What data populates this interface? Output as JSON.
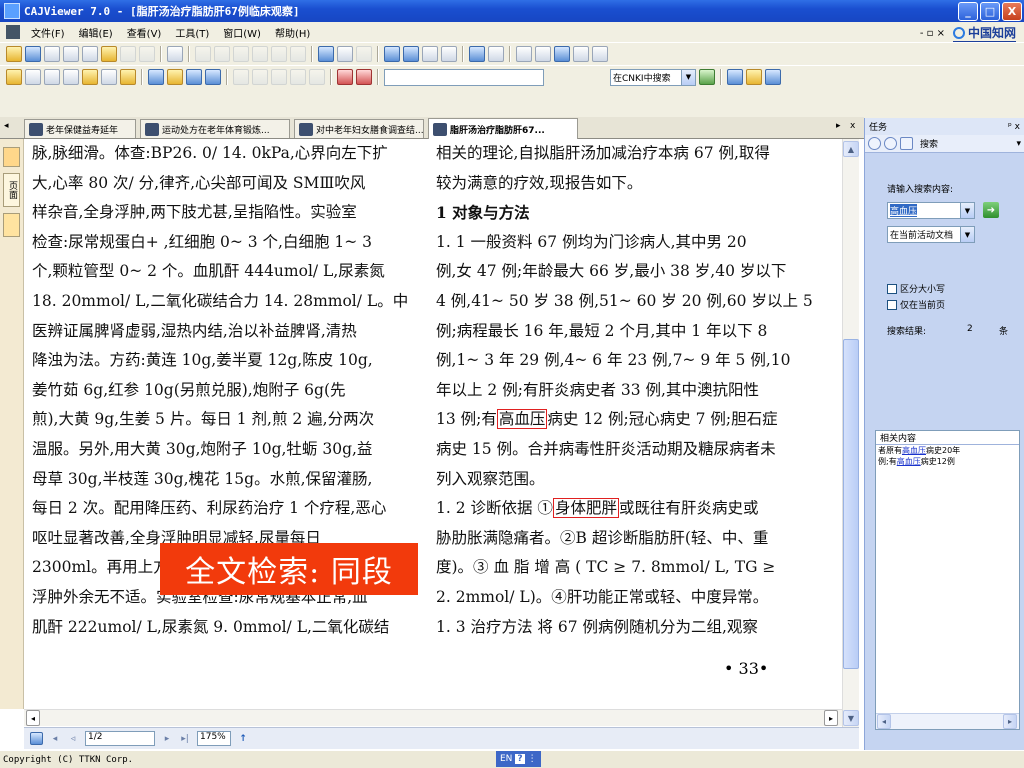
{
  "window": {
    "title": "CAJViewer 7.0 - [脂肝汤治疗脂肪肝67例临床观察]",
    "controls": [
      "_",
      "□",
      "X"
    ]
  },
  "menu": {
    "items": [
      "文件(F)",
      "编辑(E)",
      "查看(V)",
      "工具(T)",
      "窗口(W)",
      "帮助(H)"
    ],
    "right_controls": "- ▫ ×",
    "brand": "中国知网"
  },
  "toolbar2": {
    "search_scope": "在CNKI中搜索"
  },
  "tabs": [
    {
      "label": "老年保健益寿延年"
    },
    {
      "label": "运动处方在老年体育锻炼..."
    },
    {
      "label": "对中老年妇女膳食调查结..."
    },
    {
      "label": "脂肝汤治疗脂肪肝67..."
    }
  ],
  "tab_nav": {
    "left": "◂",
    "right": "▸",
    "close": "x"
  },
  "left_strip": {
    "tabs": [
      "页面"
    ]
  },
  "document": {
    "left_column": [
      "脉,脉细滑。体查:BP26. 0/ 14. 0kPa,心界向左下扩",
      "大,心率 80 次/ 分,律齐,心尖部可闻及 SMⅢ吹风",
      "样杂音,全身浮肿,两下肢尤甚,呈指陷性。实验室",
      "检查:尿常规蛋白+ ,红细胞 0~ 3 个,白细胞 1~ 3",
      "个,颗粒管型 0~ 2 个。血肌酐 444umol/ L,尿素氮",
      "18. 20mmol/ L,二氧化碳结合力 14. 28mmol/ L。中",
      "医辨证属脾肾虚弱,湿热内结,治以补益脾肾,清热",
      "降浊为法。方药:黄连 10g,姜半夏 12g,陈皮 10g,",
      "姜竹茹 6g,红参 10g(另煎兑服),炮附子 6g(先",
      "煎),大黄 9g,生姜 5 片。每日 1 剂,煎 2 遍,分两次",
      "温服。另外,用大黄 30g,炮附子 10g,牡蛎 30g,益",
      "母草 30g,半枝莲 30g,槐花 15g。水煎,保留灌肠,",
      "每日 2 次。配用降压药、利尿药治疗 1 个疗程,恶心",
      "呕吐显著改善,全身浮肿明显减轻,尿量每日",
      "2300ml。再用上方加减治疗 1 个疗程,诸症消失,",
      "浮肿外余无不适。实验室检查:尿常规基本正常,血",
      "肌酐 222umol/ L,尿素氮 9. 0mmol/ L,二氧化碳结"
    ],
    "right_column": {
      "l1": "相关的理论,自拟脂肝汤加减治疗本病 67 例,取得",
      "l2": "较为满意的疗效,现报告如下。",
      "l3": "1  对象与方法",
      "l4": "1. 1  一般资料  67 例均为门诊病人,其中男 20",
      "l5": "例,女 47 例;年龄最大 66 岁,最小 38 岁,40 岁以下",
      "l6": "4 例,41~ 50 岁 38 例,51~ 60 岁 20 例,60 岁以上 5",
      "l7": "例;病程最长 16 年,最短 2 个月,其中 1 年以下 8",
      "l8": "例,1~ 3 年 29 例,4~ 6 年 23 例,7~ 9 年 5 例,10",
      "l9": "年以上 2 例;有肝炎病史者 33 例,其中澳抗阳性",
      "l10_a": "13 例;有",
      "l10_hl": "高血压",
      "l10_b": "病史 12 例;冠心病史 7 例;胆石症",
      "l11": "病史 15 例。合并病毒性肝炎活动期及糖尿病者未",
      "l12": "列入观察范围。",
      "l13_a": "1. 2  诊断依据  ①",
      "l13_hl": "身体肥胖",
      "l13_b": "或既往有肝炎病史或",
      "l14": "胁肋胀满隐痛者。②B 超诊断脂肪肝(轻、中、重",
      "l15": "度)。③ 血 脂 增 高 ( TC ≥ 7. 8mmol/ L, TG ≥",
      "l16": "2. 2mmol/ L)。④肝功能正常或轻、中度异常。",
      "l17": "1. 3  治疗方法  将 67 例病例随机分为二组,观察"
    },
    "page_number": "• 33•",
    "overlay_banner": "全文检索: 同段"
  },
  "navbar": {
    "page": "1/2",
    "zoom": "175%"
  },
  "status": {
    "copyright": "Copyright (C) TTKN Corp.",
    "ime": "EN"
  },
  "panel": {
    "title": "任务",
    "pin": "ᵖ x",
    "nav_label": "搜索",
    "prompt": "请输入搜索内容:",
    "query": "高血压",
    "scope": "在当前活动文档",
    "case_sensitive": "区分大小写",
    "current_page_only": "仅在当前页",
    "results_label": "搜索结果:",
    "results_count": "2",
    "results_unit": "条",
    "related_header": "相关内容",
    "related": [
      {
        "pre": "者原有",
        "link": "高血压",
        "post": "病史20年"
      },
      {
        "pre": "例;有",
        "link": "高血压",
        "post": "病史12例"
      }
    ]
  }
}
